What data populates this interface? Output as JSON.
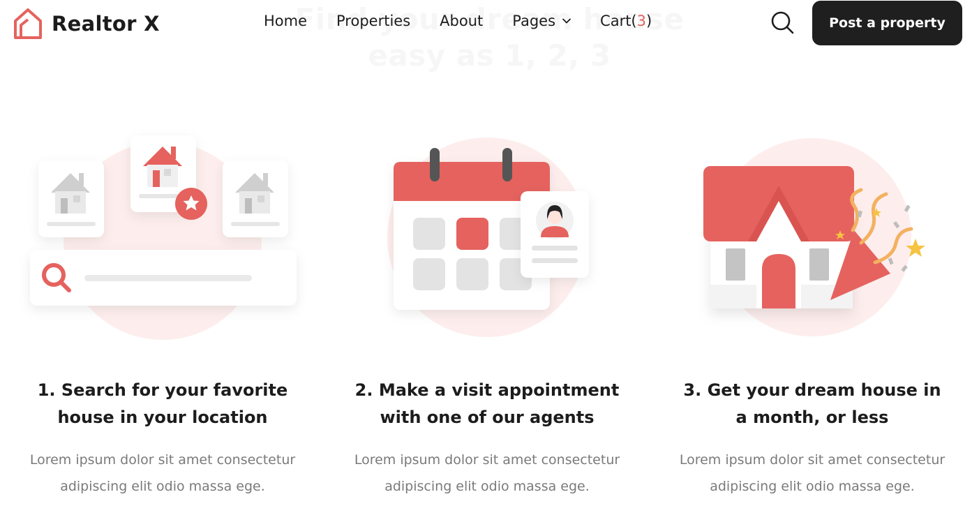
{
  "hero": {
    "title_line1": "Find your dream house",
    "title_line2": "easy as 1, 2, 3"
  },
  "brand": {
    "name": "Realtor X",
    "logo_icon": "house-outline-icon"
  },
  "nav": {
    "items": [
      {
        "label": "Home"
      },
      {
        "label": "Properties"
      },
      {
        "label": "About"
      },
      {
        "label": "Pages"
      }
    ],
    "cart_label": "Cart(",
    "cart_count": "3",
    "cart_close": ")",
    "search_icon": "search-icon",
    "post_button": "Post a property"
  },
  "steps": [
    {
      "title": "1. Search for your favorite\nhouse in your location",
      "description": "Lorem ipsum dolor sit amet consectetur\nadipiscing elit odio massa ege."
    },
    {
      "title": "2. Make a visit appointment\nwith one of our agents",
      "description": "Lorem ipsum dolor sit amet consectetur\nadipiscing elit odio massa ege."
    },
    {
      "title": "3. Get your dream house in\na month, or less",
      "description": "Lorem ipsum dolor sit amet consectetur\nadipiscing elit odio massa ege."
    }
  ],
  "colors": {
    "accent": "#e5625e",
    "dark": "#1f1f1f",
    "muted_text": "#7a7a7a",
    "soft_pink": "#fdeeed"
  }
}
